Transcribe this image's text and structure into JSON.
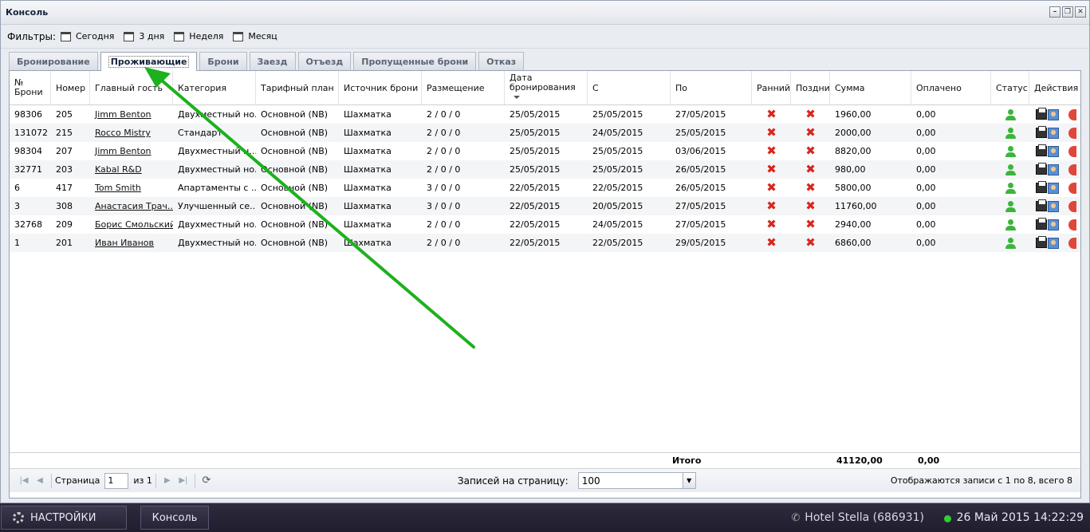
{
  "window": {
    "title": "Консоль"
  },
  "filters": {
    "label": "Фильтры:",
    "items": [
      "Сегодня",
      "3 дня",
      "Неделя",
      "Месяц"
    ]
  },
  "tabs": [
    {
      "label": "Бронирование",
      "active": false
    },
    {
      "label": "Проживающие",
      "active": true
    },
    {
      "label": "Брони",
      "active": false
    },
    {
      "label": "Заезд",
      "active": false
    },
    {
      "label": "Отъезд",
      "active": false
    },
    {
      "label": "Пропущенные брони",
      "active": false
    },
    {
      "label": "Отказ",
      "active": false
    }
  ],
  "grid": {
    "columns": [
      "№ Брони",
      "Номер",
      "Главный гость",
      "Категория",
      "Тарифный план",
      "Источник брони",
      "Размещение",
      "Дата бронирования",
      "С",
      "По",
      "Ранний з",
      "Поздний",
      "Сумма",
      "Оплачено",
      "Статус",
      "Действия"
    ],
    "sorted_column": "Дата бронирования",
    "rows": [
      {
        "id": "98306",
        "room": "205",
        "guest": "Jimm Benton",
        "category": "Двухместный но...",
        "rate": "Основной (NB)",
        "source": "Шахматка",
        "placement": "2 / 0 / 0",
        "booked": "25/05/2015",
        "from": "25/05/2015",
        "to": "27/05/2015",
        "sum": "1960,00",
        "paid": "0,00"
      },
      {
        "id": "131072",
        "room": "215",
        "guest": "Rocco Mistry",
        "category": "Стандарт",
        "rate": "Основной (NB)",
        "source": "Шахматка",
        "placement": "2 / 0 / 0",
        "booked": "25/05/2015",
        "from": "24/05/2015",
        "to": "25/05/2015",
        "sum": "2000,00",
        "paid": "0,00"
      },
      {
        "id": "98304",
        "room": "207",
        "guest": "Jimm Benton",
        "category": "Двухместный н...",
        "rate": "Основной (NB)",
        "source": "Шахматка",
        "placement": "2 / 0 / 0",
        "booked": "25/05/2015",
        "from": "25/05/2015",
        "to": "03/06/2015",
        "sum": "8820,00",
        "paid": "0,00"
      },
      {
        "id": "32771",
        "room": "203",
        "guest": "Kabal R&D",
        "category": "Двухместный но...",
        "rate": "Основной (NB)",
        "source": "Шахматка",
        "placement": "2 / 0 / 0",
        "booked": "25/05/2015",
        "from": "25/05/2015",
        "to": "26/05/2015",
        "sum": "980,00",
        "paid": "0,00"
      },
      {
        "id": "6",
        "room": "417",
        "guest": "Tom Smith",
        "category": "Апартаменты с ...",
        "rate": "Основной (NB)",
        "source": "Шахматка",
        "placement": "3 / 0 / 0",
        "booked": "22/05/2015",
        "from": "22/05/2015",
        "to": "26/05/2015",
        "sum": "5800,00",
        "paid": "0,00"
      },
      {
        "id": "3",
        "room": "308",
        "guest": "Анастасия Трач...",
        "category": "Улучшенный се...",
        "rate": "Основной (NB)",
        "source": "Шахматка",
        "placement": "3 / 0 / 0",
        "booked": "22/05/2015",
        "from": "20/05/2015",
        "to": "27/05/2015",
        "sum": "11760,00",
        "paid": "0,00"
      },
      {
        "id": "32768",
        "room": "209",
        "guest": "Борис Смольский",
        "category": "Двухместный но...",
        "rate": "Основной (NB)",
        "source": "Шахматка",
        "placement": "2 / 0 / 0",
        "booked": "22/05/2015",
        "from": "24/05/2015",
        "to": "27/05/2015",
        "sum": "2940,00",
        "paid": "0,00"
      },
      {
        "id": "1",
        "room": "201",
        "guest": "Иван Иванов",
        "category": "Двухместный но...",
        "rate": "Основной (NB)",
        "source": "Шахматка",
        "placement": "2 / 0 / 0",
        "booked": "22/05/2015",
        "from": "22/05/2015",
        "to": "29/05/2015",
        "sum": "6860,00",
        "paid": "0,00"
      }
    ],
    "totals": {
      "label": "Итого",
      "sum": "41120,00",
      "paid": "0,00"
    }
  },
  "pager": {
    "page_label": "Страница",
    "page_value": "1",
    "of_label": "из 1",
    "per_page_label": "Записей на страницу:",
    "per_page_value": "100",
    "summary": "Отображаются записи с 1 по 8, всего 8"
  },
  "taskbar": {
    "settings_label": "НАСТРОЙКИ",
    "console_label": "Консоль",
    "hotel": "Hotel Stella (686931)",
    "datetime": "26 Май 2015 14:22:29"
  },
  "colors": {
    "status_green": "#3cb53c",
    "reject_red": "#d9261c",
    "annotation_arrow": "#1db11d"
  }
}
